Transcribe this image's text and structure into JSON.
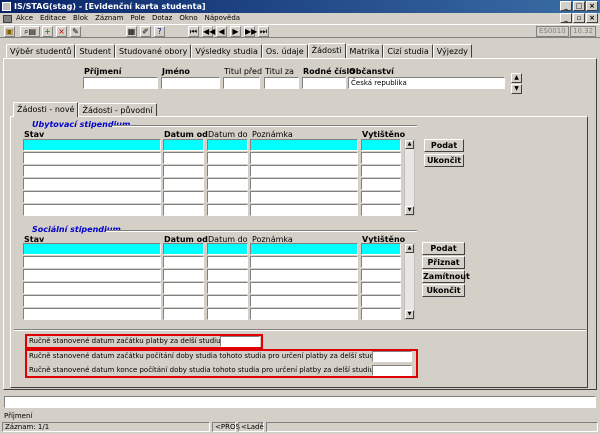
{
  "window": {
    "title": "IS/STAG(stag) - [Evidenční karta studenta]"
  },
  "menu": [
    "Akce",
    "Editace",
    "Blok",
    "Záznam",
    "Pole",
    "Dotaz",
    "Okno",
    "Nápověda"
  ],
  "toolbar": {
    "code1": "ES0010",
    "code2": "10.32"
  },
  "tabs": [
    "Výběr studentů",
    "Student",
    "Studované obory",
    "Výsledky studia",
    "Os. údaje",
    "Žádosti",
    "Matrika",
    "Cizí studia",
    "Výjezdy"
  ],
  "active_tab": "Žádosti",
  "header": {
    "prijmeni": "Příjmení",
    "jmeno": "Jméno",
    "titul_pred": "Titul před",
    "titul_za": "Titul za",
    "rodne_cislo": "Rodné číslo",
    "obcanstvi": "Občanství",
    "obcanstvi_value": "Česká republika"
  },
  "subtabs": [
    "Žádosti - nové",
    "Žádosti - původní"
  ],
  "ubytovaci": {
    "title": "Ubytovací stipendium",
    "cols": {
      "stav": "Stav",
      "datum_od": "Datum od",
      "datum_do": "Datum do",
      "poznamka": "Poznámka",
      "vytisteno": "Vytištěno"
    },
    "buttons": {
      "podat": "Podat",
      "ukoncit": "Ukončit"
    }
  },
  "socialni": {
    "title": "Sociální stipendium",
    "cols": {
      "stav": "Stav",
      "datum_od": "Datum od",
      "datum_do": "Datum do",
      "poznamka": "Poznámka",
      "vytisteno": "Vytištěno"
    },
    "buttons": {
      "podat": "Podat",
      "priznat": "Přiznat",
      "zamitnout": "Zamítnout",
      "ukoncit": "Ukončit"
    }
  },
  "dates": {
    "zacatek_platby": "Ručně stanovené datum začátku platby za delší studium",
    "zacatek_pocitani": "Ručně stanovené datum začátku počítání doby studia tohoto studia pro určení platby za delší studium",
    "konec_pocitani": "Ručně stanovené datum konce počítání doby studia tohoto studia pro určení platby za delší studium"
  },
  "status": {
    "hint": "Příjmení",
    "record": "Záznam: 1/1",
    "mode1": "<PŘOS",
    "mode2": "<Ladě"
  }
}
